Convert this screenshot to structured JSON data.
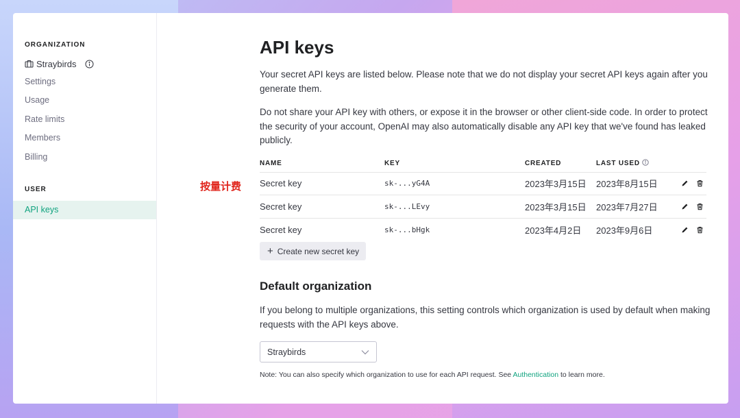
{
  "sidebar": {
    "org_heading": "ORGANIZATION",
    "org_name": "Straybirds",
    "org_items": [
      {
        "label": "Settings"
      },
      {
        "label": "Usage"
      },
      {
        "label": "Rate limits"
      },
      {
        "label": "Members"
      },
      {
        "label": "Billing"
      }
    ],
    "user_heading": "USER",
    "active_item": "API keys"
  },
  "main": {
    "title": "API keys",
    "intro": "Your secret API keys are listed below. Please note that we do not display your secret API keys again after you generate them.",
    "warning": "Do not share your API key with others, or expose it in the browser or other client-side code. In order to protect the security of your account, OpenAI may also automatically disable any API key that we've found has leaked publicly.",
    "annotation": "按量计费",
    "table": {
      "headers": {
        "name": "NAME",
        "key": "KEY",
        "created": "CREATED",
        "last_used": "LAST USED"
      },
      "rows": [
        {
          "name": "Secret key",
          "key": "sk-...yG4A",
          "created": "2023年3月15日",
          "last_used": "2023年8月15日"
        },
        {
          "name": "Secret key",
          "key": "sk-...LEvy",
          "created": "2023年3月15日",
          "last_used": "2023年7月27日"
        },
        {
          "name": "Secret key",
          "key": "sk-...bHgk",
          "created": "2023年4月2日",
          "last_used": "2023年9月6日"
        }
      ]
    },
    "create_button": "Create new secret key",
    "default_org": {
      "title": "Default organization",
      "description": "If you belong to multiple organizations, this setting controls which organization is used by default when making requests with the API keys above.",
      "selected": "Straybirds",
      "note_prefix": "Note: You can also specify which organization to use for each API request. See ",
      "note_link": "Authentication",
      "note_suffix": " to learn more."
    }
  },
  "colors": {
    "accent": "#10a37f",
    "annotation": "#e0241b",
    "active_bg": "#e6f3ef"
  }
}
